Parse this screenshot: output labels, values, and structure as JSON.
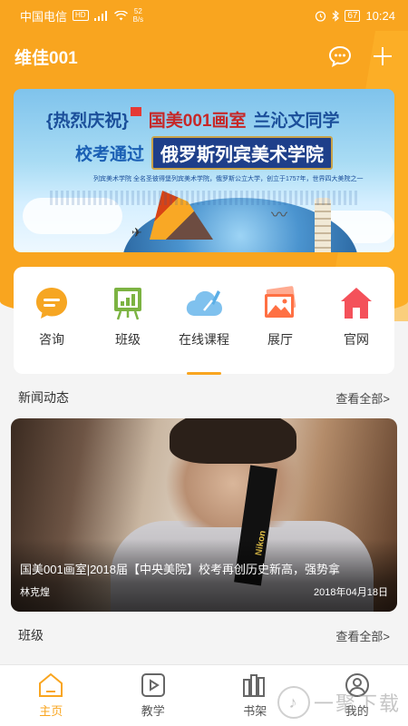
{
  "status_bar": {
    "carrier": "中国电信",
    "hd": "HD",
    "net_speed_value": "52",
    "net_speed_unit": "B/s",
    "battery": "67",
    "time": "10:24"
  },
  "app_bar": {
    "title": "维佳001",
    "message_icon": "chat-bubble-icon",
    "add_icon": "plus-icon"
  },
  "banner": {
    "left_tag": "{热烈庆祝}",
    "studio": "国美001画室",
    "student": "兰沁文同学",
    "pass_text": "校考通过",
    "school": "俄罗斯列宾美术学院",
    "caption": "列宾美术学院 全名圣彼得堡列宾美术学院，俄罗斯公立大学，创立于1757年，世界四大美院之一"
  },
  "quick_actions": [
    {
      "label": "咨询",
      "icon": "chat-icon",
      "color": "#f6a623"
    },
    {
      "label": "班级",
      "icon": "easel-chart-icon",
      "color": "#7cb342"
    },
    {
      "label": "在线课程",
      "icon": "cloud-pen-icon",
      "color": "#5aaee6"
    },
    {
      "label": "展厅",
      "icon": "picture-gallery-icon",
      "color": "#ff7043"
    },
    {
      "label": "官网",
      "icon": "home-icon",
      "color": "#f4515a"
    }
  ],
  "news_section": {
    "title": "新闻动态",
    "more": "查看全部>"
  },
  "news_item": {
    "title": "国美001画室|2018届【中央美院】校考再创历史新高，强势拿",
    "author": "林克煌",
    "date": "2018年04月18日",
    "camera_strap_text": "Nikon"
  },
  "class_section": {
    "title": "班级",
    "more": "查看全部>"
  },
  "tabbar": [
    {
      "label": "主页",
      "icon": "home-outline-icon",
      "active": true
    },
    {
      "label": "教学",
      "icon": "play-video-icon",
      "active": false
    },
    {
      "label": "书架",
      "icon": "bookshelf-icon",
      "active": false
    },
    {
      "label": "我的",
      "icon": "user-icon",
      "active": false
    }
  ],
  "watermark": {
    "text": "一聚下载"
  },
  "colors": {
    "brand": "#f9a51f",
    "background": "#f4f4f4"
  }
}
